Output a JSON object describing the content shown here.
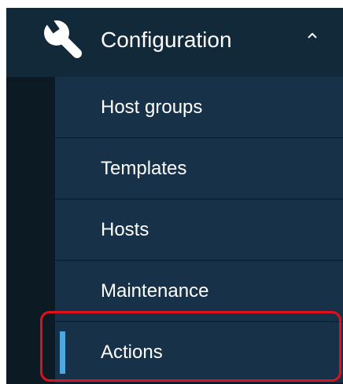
{
  "menu": {
    "section": {
      "label": "Configuration",
      "icon": "wrench-icon",
      "expand_icon": "chevron-up-icon"
    },
    "items": [
      {
        "label": "Host groups"
      },
      {
        "label": "Templates"
      },
      {
        "label": "Hosts"
      },
      {
        "label": "Maintenance"
      },
      {
        "label": "Actions",
        "selected": true
      }
    ],
    "colors": {
      "sidebar_dark": "#0b1a23",
      "section_bg": "#12293a",
      "submenu_bg": "#163148",
      "selected_bar": "#4ea8dd",
      "annotation_box": "#e0101d"
    }
  }
}
